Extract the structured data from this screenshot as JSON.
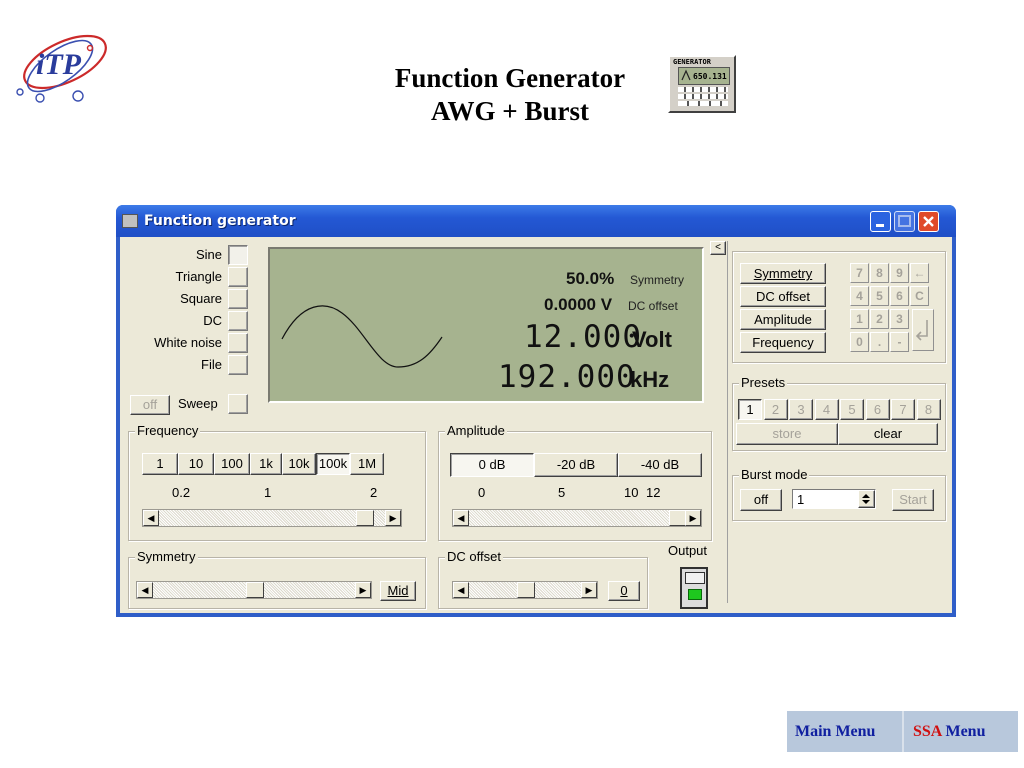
{
  "slide": {
    "title_line1": "Function Generator",
    "title_line2": "AWG + Burst",
    "logo_text": "iTP",
    "icon_text": "GENERATOR",
    "icon_value": "650.131"
  },
  "window": {
    "title": "Function generator",
    "min_icon": "minimize-icon",
    "max_icon": "maximize-icon",
    "close_icon": "close-icon"
  },
  "waveforms": {
    "items": [
      {
        "label": "Sine",
        "selected": true
      },
      {
        "label": "Triangle",
        "selected": false
      },
      {
        "label": "Square",
        "selected": false
      },
      {
        "label": "DC",
        "selected": false
      },
      {
        "label": "White noise",
        "selected": false
      },
      {
        "label": "File",
        "selected": false
      }
    ],
    "sweep_off_label": "off",
    "sweep_label": "Sweep"
  },
  "display": {
    "symmetry_value": "50.0%",
    "symmetry_label": "Symmetry",
    "dc_value": "0.0000 V",
    "dc_label": "DC offset",
    "amplitude_value": "12.000",
    "amplitude_unit": "Volt",
    "frequency_value": "192.000",
    "frequency_unit": "kHz",
    "collapse_label": "<"
  },
  "entry": {
    "symmetry": "Symmetry",
    "dc_offset": "DC offset",
    "amplitude": "Amplitude",
    "frequency": "Frequency",
    "keys": [
      "7",
      "8",
      "9",
      "←",
      "4",
      "5",
      "6",
      "C",
      "1",
      "2",
      "3",
      "0",
      ".",
      "-"
    ],
    "enter_icon": "enter-arrow-icon"
  },
  "presets": {
    "title": "Presets",
    "items": [
      "1",
      "2",
      "3",
      "4",
      "5",
      "6",
      "7",
      "8"
    ],
    "active": "1",
    "store": "store",
    "clear": "clear"
  },
  "burst": {
    "title": "Burst mode",
    "off": "off",
    "count": "1",
    "start": "Start"
  },
  "frequency": {
    "title": "Frequency",
    "ranges": [
      "1",
      "10",
      "100",
      "1k",
      "10k",
      "100k",
      "1M"
    ],
    "active": "100k",
    "scale": [
      "0.2",
      "1",
      "2"
    ],
    "slider_fraction": 0.94
  },
  "amplitude": {
    "title": "Amplitude",
    "attenuation": [
      "0 dB",
      "-20 dB",
      "-40 dB"
    ],
    "active": "0 dB",
    "scale": [
      "0",
      "5",
      "10",
      "12"
    ],
    "slider_fraction": 1.0
  },
  "symmetry": {
    "title": "Symmetry",
    "mid_label": "Mid",
    "slider_fraction": 0.5
  },
  "dc_offset": {
    "title": "DC offset",
    "zero_label": "0",
    "slider_fraction": 0.5
  },
  "output": {
    "label": "Output",
    "state": "on"
  },
  "nav": {
    "main_menu": "Main Menu",
    "ssa_prefix": "SSA",
    "ssa_menu": "Menu"
  }
}
